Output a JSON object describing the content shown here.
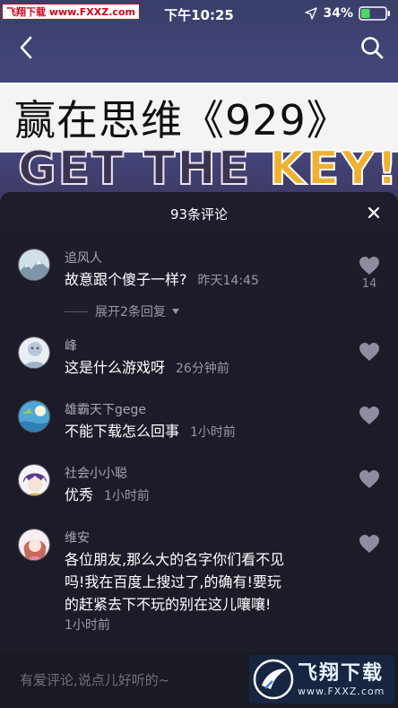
{
  "status_bar": {
    "watermark": "飞翔下载 www.FXXZ.com",
    "time": "下午10:25",
    "battery": "34%"
  },
  "nav": {
    "back_icon": "chevron-left-icon",
    "search_icon": "search-icon"
  },
  "video": {
    "title": "赢在思维《929》",
    "overlay_text_white": "GET THE ",
    "overlay_text_orange": "KEY!"
  },
  "comments_sheet": {
    "count_label": "93条评论",
    "comments": [
      {
        "username": "追风人",
        "content": "故意跟个傻子一样?",
        "time": "昨天14:45",
        "like_count": "14",
        "expand_label": "展开2条回复"
      },
      {
        "username": "峰",
        "content": "这是什么游戏呀",
        "time": "26分钟前"
      },
      {
        "username": "雄霸天下gege",
        "content": "不能下载怎么回事",
        "time": "1小时前"
      },
      {
        "username": "社会小小聪",
        "content": "优秀",
        "time": "1小时前"
      },
      {
        "username": "维安",
        "content_lines": [
          "各位朋友,那么大的名字你们看不见",
          "吗!我在百度上搜过了,的确有!要玩",
          "的赶紧去下不玩的别在这儿嚷嚷!"
        ],
        "time": "1小时前"
      }
    ]
  },
  "input": {
    "placeholder": "有爱评论,说点儿好听的~"
  },
  "watermark_bottom": {
    "title": "飞翔下载",
    "url": "www.FXXZ.com"
  },
  "colors": {
    "sheet_bg": "#1c1b28",
    "like_icon": "#8d8ca0",
    "muted_text": "#9897aa"
  }
}
